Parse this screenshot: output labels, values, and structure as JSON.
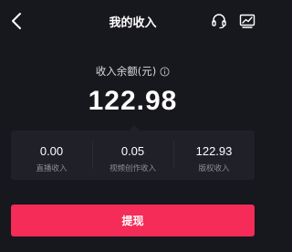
{
  "header": {
    "title": "我的收入",
    "back_icon": "chevron-left-icon",
    "support_icon": "headset-icon",
    "stats_icon": "trend-chart-icon"
  },
  "balance": {
    "label": "收入余额(元)",
    "info_icon": "info-icon",
    "amount": "122.98"
  },
  "breakdown": [
    {
      "value": "0.00",
      "label": "直播收入"
    },
    {
      "value": "0.05",
      "label": "视频创作收入"
    },
    {
      "value": "122.93",
      "label": "版权收入"
    }
  ],
  "actions": {
    "withdraw_label": "提现"
  },
  "colors": {
    "background": "#17171e",
    "panel": "#202029",
    "accent": "#f52b58"
  }
}
